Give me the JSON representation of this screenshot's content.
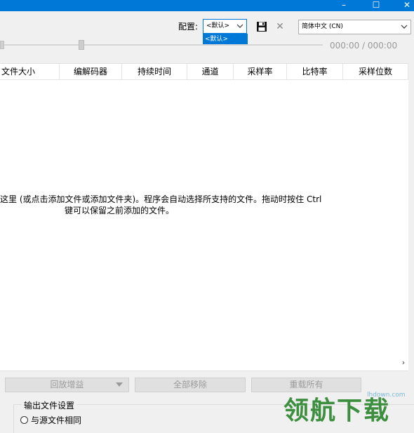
{
  "window": {
    "minimize_glyph": "–",
    "maximize_glyph": "☐",
    "close_glyph": "✕"
  },
  "toolbar": {
    "preset_label": "配置:",
    "preset_value": "<默认>",
    "preset_dropdown_item": "<默认>",
    "language_value": "简体中文 (CN)"
  },
  "player": {
    "time_display": "000:00 / 000:00"
  },
  "list": {
    "columns": [
      "文件大小",
      "编解码器",
      "持续时间",
      "通道",
      "采样率",
      "比特率",
      "采样位数"
    ],
    "empty_hint_line1": "这里 (或点击添加文件或添加文件夹)。程序会自动选择所支持的文件。拖动时按住 Ctrl",
    "empty_hint_line2": "键可以保留之前添加的文件。",
    "scroll_right_glyph": "›"
  },
  "buttons": {
    "replay_gain": "回放增益",
    "remove_all": "全部移除",
    "reload_all": "重载所有"
  },
  "output": {
    "title": "输出文件设置",
    "same_as_source": "与源文件相同"
  },
  "watermark": {
    "url": "lhdown.com",
    "logo": "领航下载"
  },
  "colors": {
    "accent": "#0078d7",
    "watermark": "#3d8f3f"
  }
}
